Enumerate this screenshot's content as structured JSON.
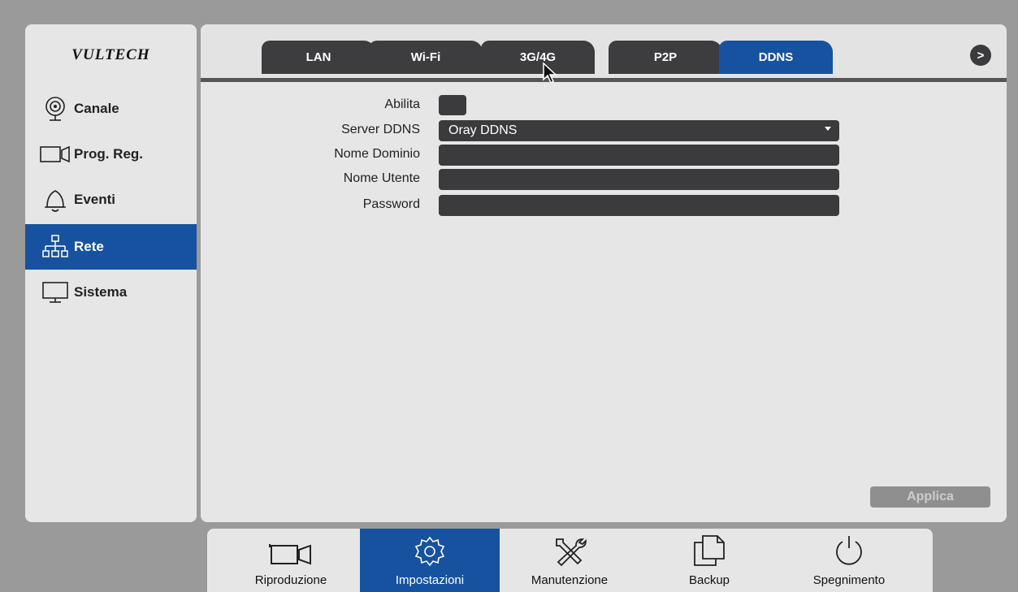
{
  "brand": {
    "logo_text": "VULTECH"
  },
  "sidebar": {
    "items": [
      {
        "label": "Canale",
        "icon": "camera-lens-icon",
        "active": false
      },
      {
        "label": "Prog. Reg.",
        "icon": "record-schedule-icon",
        "active": false
      },
      {
        "label": "Eventi",
        "icon": "bell-icon",
        "active": false
      },
      {
        "label": "Rete",
        "icon": "network-icon",
        "active": true
      },
      {
        "label": "Sistema",
        "icon": "monitor-icon",
        "active": false
      }
    ]
  },
  "tabs": [
    {
      "label": "LAN",
      "active": false
    },
    {
      "label": "Wi-Fi",
      "active": false
    },
    {
      "label": "3G/4G",
      "active": false
    },
    {
      "label": "P2P",
      "active": false
    },
    {
      "label": "DDNS",
      "active": true
    }
  ],
  "next_arrow": ">",
  "form": {
    "enable_label": "Abilita",
    "enable_checked": false,
    "server_label": "Server DDNS",
    "server_value": "Oray DDNS",
    "domain_label": "Nome Dominio",
    "domain_value": "",
    "user_label": "Nome Utente",
    "user_value": "",
    "password_label": "Password",
    "password_value": ""
  },
  "apply_label": "Applica",
  "bottombar": {
    "items": [
      {
        "label": "Riproduzione",
        "icon": "video-camera-icon",
        "active": false
      },
      {
        "label": "Impostazioni",
        "icon": "gear-icon",
        "active": true
      },
      {
        "label": "Manutenzione",
        "icon": "tools-icon",
        "active": false
      },
      {
        "label": "Backup",
        "icon": "copy-files-icon",
        "active": false
      },
      {
        "label": "Spegnimento",
        "icon": "power-icon",
        "active": false
      }
    ]
  },
  "colors": {
    "accent": "#1752a0",
    "field": "#3b3b3d",
    "panel": "#e6e6e6"
  }
}
